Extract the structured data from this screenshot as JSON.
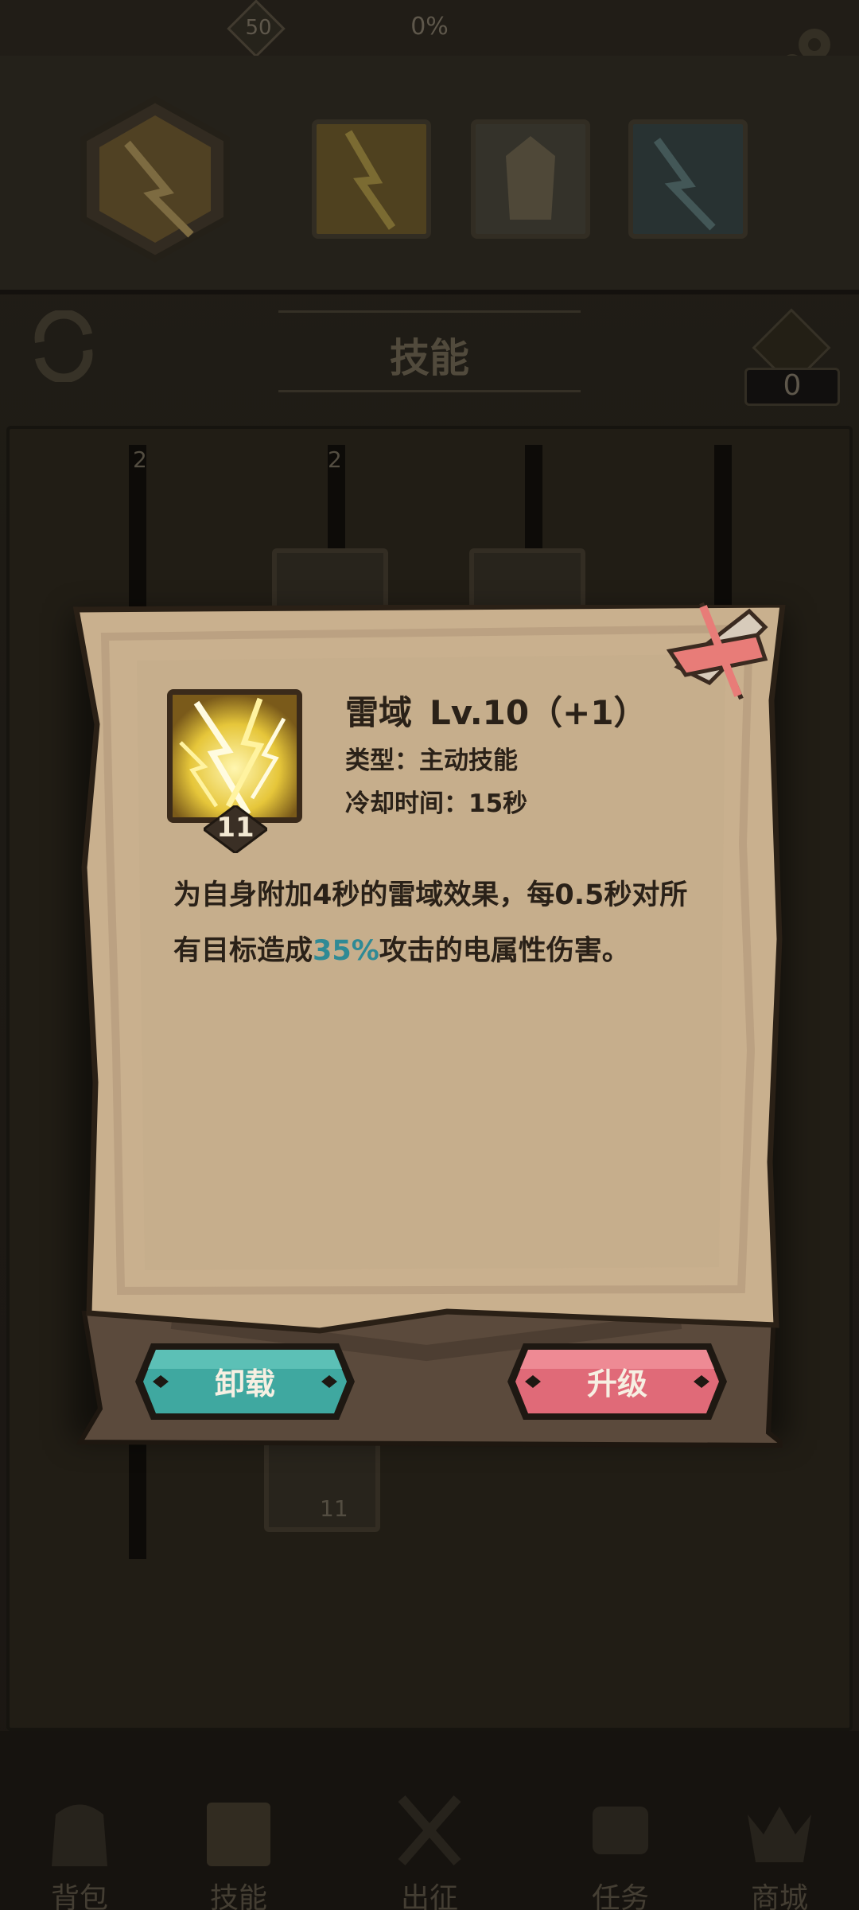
{
  "topbar": {
    "level": "50",
    "percent": "0%"
  },
  "tab": {
    "title": "技能",
    "points": "0"
  },
  "tree": {
    "badges": [
      "2",
      "2",
      "11"
    ]
  },
  "popup": {
    "skill_name": "雷域",
    "skill_level": "Lv.10（+1）",
    "type_label": "类型：",
    "type_value": "主动技能",
    "cooldown_label": "冷却时间：",
    "cooldown_value": "15秒",
    "icon_level": "11",
    "desc_part1": "为自身附加4秒的雷域效果，每0.5秒对所有目标造成",
    "desc_highlight": "35%",
    "desc_part2": "攻击的电属性伤害。"
  },
  "buttons": {
    "unload": "卸载",
    "upgrade": "升级"
  },
  "nav": [
    {
      "label": "背包",
      "icon": "backpack-icon"
    },
    {
      "label": "技能",
      "icon": "skill-book-icon"
    },
    {
      "label": "出征",
      "icon": "crossed-swords-icon"
    },
    {
      "label": "任务",
      "icon": "scroll-icon"
    },
    {
      "label": "商城",
      "icon": "shop-crown-icon"
    }
  ],
  "colors": {
    "parchment": "#c9b08e",
    "parchment_border": "#2a2016",
    "highlight_text": "#2f8a95",
    "unload_button": "#3fa8a0",
    "upgrade_button": "#e06a78",
    "close_accent": "#e87c78"
  }
}
